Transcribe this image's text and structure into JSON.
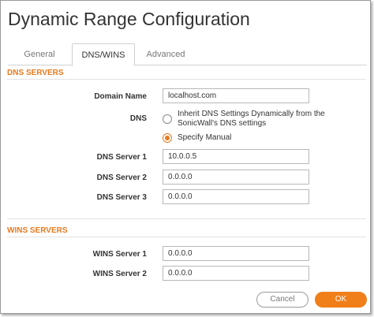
{
  "dialog": {
    "title": "Dynamic Range Configuration"
  },
  "tabs": [
    {
      "label": "General",
      "active": false
    },
    {
      "label": "DNS/WINS",
      "active": true
    },
    {
      "label": "Advanced",
      "active": false
    }
  ],
  "dns_section": {
    "title": "DNS SERVERS",
    "domain_name_label": "Domain Name",
    "domain_name_value": "localhost.com",
    "dns_label": "DNS",
    "option_inherit": "Inherit DNS Settings Dynamically from the SonicWall's DNS settings",
    "option_inherit_selected": false,
    "option_manual": "Specify Manual",
    "option_manual_selected": true,
    "server1_label": "DNS Server 1",
    "server1_value": "10.0.0.5",
    "server2_label": "DNS Server 2",
    "server2_value": "0.0.0.0",
    "server3_label": "DNS Server 3",
    "server3_value": "0.0.0.0"
  },
  "wins_section": {
    "title": "WINS SERVERS",
    "server1_label": "WINS Server 1",
    "server1_value": "0.0.0.0",
    "server2_label": "WINS Server 2",
    "server2_value": "0.0.0.0"
  },
  "buttons": {
    "cancel_label": "Cancel",
    "ok_label": "OK"
  },
  "colors": {
    "accent": "#e87a1e",
    "ok_button": "#f07f1a"
  }
}
